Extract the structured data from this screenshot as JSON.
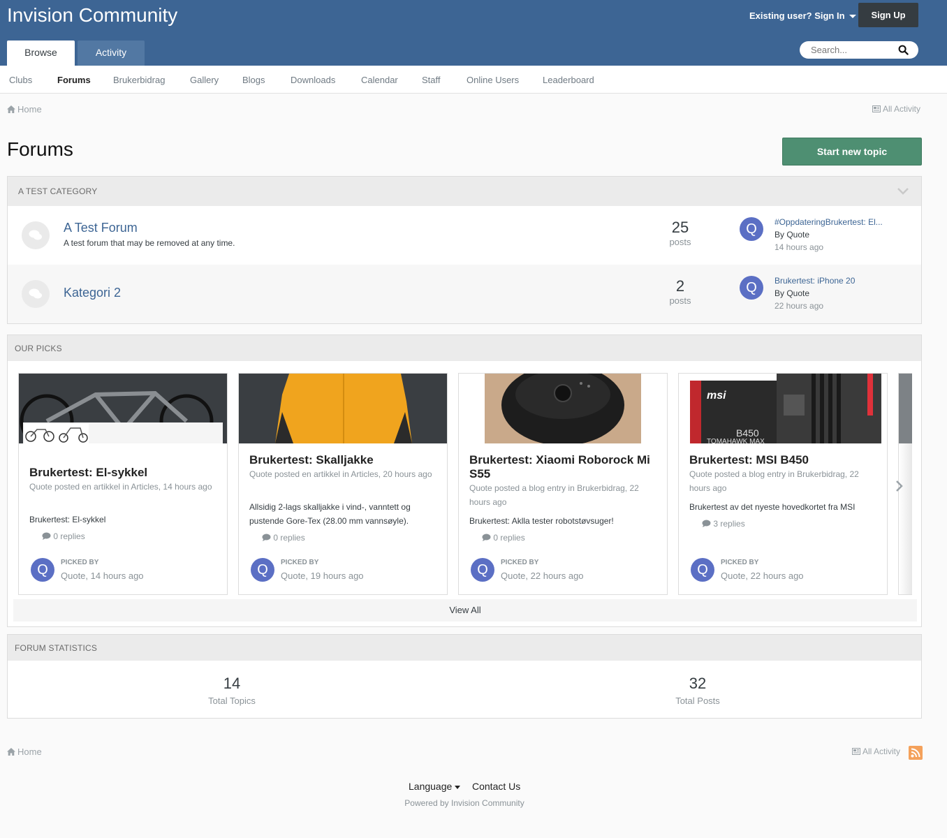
{
  "header": {
    "site_title": "Invision Community",
    "signin_label": "Existing user? Sign In",
    "signup_label": "Sign Up",
    "search_placeholder": "Search...",
    "tabs": [
      {
        "label": "Browse",
        "active": true
      },
      {
        "label": "Activity",
        "active": false
      }
    ]
  },
  "subnav": {
    "items": [
      {
        "label": "Clubs"
      },
      {
        "label": "Forums"
      },
      {
        "label": "Brukerbidrag"
      },
      {
        "label": "Gallery"
      },
      {
        "label": "Blogs"
      },
      {
        "label": "Downloads"
      },
      {
        "label": "Calendar"
      },
      {
        "label": "Staff"
      },
      {
        "label": "Online Users"
      },
      {
        "label": "Leaderboard"
      }
    ],
    "active": "Forums"
  },
  "breadcrumb": {
    "home": "Home",
    "all_activity": "All Activity"
  },
  "page": {
    "title": "Forums",
    "start_topic": "Start new topic"
  },
  "category": {
    "title": "A TEST CATEGORY",
    "forums": [
      {
        "name": "A Test Forum",
        "description": "A test forum that may be removed at any time.",
        "posts": "25",
        "posts_label": "posts",
        "last_title": "#OppdateringBrukertest: El...",
        "last_by": "By Quote",
        "last_time": "14 hours ago",
        "avatar_letter": "Q"
      },
      {
        "name": "Kategori 2",
        "description": "",
        "posts": "2",
        "posts_label": "posts",
        "last_title": "Brukertest: iPhone 20",
        "last_by": "By Quote",
        "last_time": "22 hours ago",
        "avatar_letter": "Q"
      }
    ]
  },
  "picks": {
    "title": "OUR PICKS",
    "view_all": "View All",
    "picked_label": "PICKED BY",
    "cards": [
      {
        "title": "Brukertest: El-sykkel",
        "meta": "Quote posted en artikkel in Articles, 14 hours ago",
        "excerpt": "Brukertest: El-sykkel",
        "replies": "0 replies",
        "picked_by": "Quote, 14 hours ago",
        "avatar_letter": "Q"
      },
      {
        "title": "Brukertest: Skalljakke",
        "meta": "Quote posted en artikkel in Articles, 20 hours ago",
        "excerpt": "Allsidig 2-lags skalljakke i vind-, vanntett og pustende Gore-Tex (28.00 mm vannsøyle).",
        "replies": "0 replies",
        "picked_by": "Quote, 19 hours ago",
        "avatar_letter": "Q"
      },
      {
        "title": "Brukertest: Xiaomi Roborock Mi S55",
        "meta": "Quote posted a blog entry in Brukerbidrag, 22 hours ago",
        "excerpt": "Brukertest: Aklla tester robotstøvsuger!",
        "replies": "0 replies",
        "picked_by": "Quote, 22 hours ago",
        "avatar_letter": "Q"
      },
      {
        "title": "Brukertest: MSI B450",
        "meta": "Quote posted a blog entry in Brukerbidrag, 22 hours ago",
        "excerpt": "Brukertest av det nyeste hovedkortet fra MSI",
        "replies": "3 replies",
        "picked_by": "Quote, 22 hours ago",
        "avatar_letter": "Q"
      }
    ],
    "image_text": {
      "msi": "msi",
      "b450": "B450",
      "tomahawk": "TOMAHAWK MAX"
    }
  },
  "stats": {
    "title": "FORUM STATISTICS",
    "topics": "14",
    "topics_label": "Total Topics",
    "posts": "32",
    "posts_label": "Total Posts"
  },
  "footer": {
    "home": "Home",
    "all_activity": "All Activity",
    "language": "Language",
    "contact": "Contact Us",
    "powered": "Powered by Invision Community"
  },
  "colors": {
    "header_bg": "#3d6594",
    "accent_green": "#4e8f72",
    "avatar": "#5b6fc4",
    "link": "#3d6594"
  }
}
